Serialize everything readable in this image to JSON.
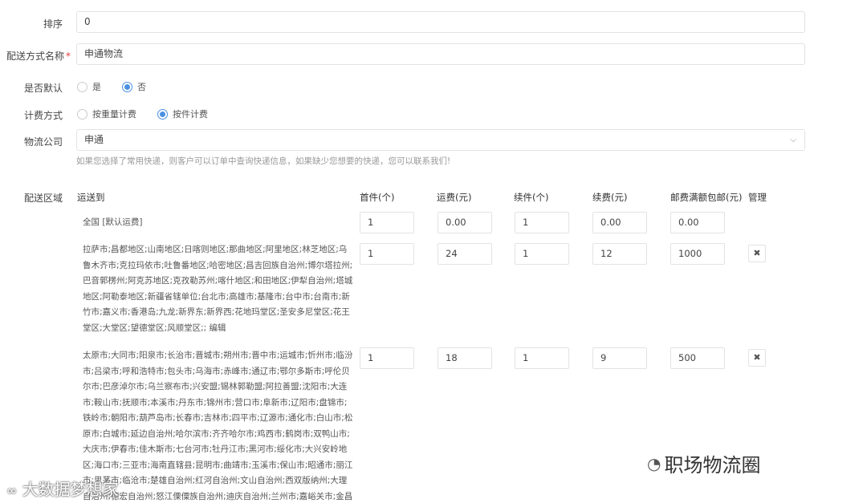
{
  "form": {
    "sort_label": "排序",
    "sort_value": "0",
    "name_label": "配送方式名称",
    "name_required": "*",
    "name_value": "申通物流",
    "default_label": "是否默认",
    "default_yes": "是",
    "default_no": "否",
    "default_selected": "否",
    "billing_label": "计费方式",
    "billing_weight": "按重量计费",
    "billing_piece": "按件计费",
    "billing_selected": "按件计费",
    "company_label": "物流公司",
    "company_value": "申通",
    "company_hint": "如果您选择了常用快递，则客户可以订单中查询快递信息，如果缺少您想要的快递，您可以联系我们!"
  },
  "table": {
    "section_label": "配送区域",
    "headers": {
      "dest": "运送到",
      "first": "首件(个)",
      "first_fee": "运费(元)",
      "extra": "续件(个)",
      "extra_fee": "续费(元)",
      "free": "邮费满额包邮(元)",
      "manage": "管理"
    },
    "rows": [
      {
        "region": "全国 [默认运费]",
        "first": "1",
        "first_fee": "0.00",
        "extra": "1",
        "extra_fee": "0.00",
        "free": "0.00"
      },
      {
        "region": "拉萨市;昌都地区;山南地区;日喀则地区;那曲地区;阿里地区;林芝地区;乌鲁木齐市;克拉玛依市;吐鲁番地区;哈密地区;昌吉回族自治州;博尔塔拉州;巴音郭楞州;阿克苏地区;克孜勒苏州;喀什地区;和田地区;伊犁自治州;塔城地区;阿勒泰地区;新疆省辖单位;台北市;高雄市;基隆市;台中市;台南市;新竹市;嘉义市;香港岛;九龙;新界东;新界西;花地玛堂区;圣安多尼堂区;花王堂区;大堂区;望德堂区;风顺堂区;; 编辑",
        "first": "1",
        "first_fee": "24",
        "extra": "1",
        "extra_fee": "12",
        "free": "1000"
      },
      {
        "region": "太原市;大同市;阳泉市;长治市;晋城市;朔州市;晋中市;运城市;忻州市;临汾市;吕梁市;呼和浩特市;包头市;乌海市;赤峰市;通辽市;鄂尔多斯市;呼伦贝尔市;巴彦淖尔市;乌兰察布市;兴安盟;锡林郭勒盟;阿拉善盟;沈阳市;大连市;鞍山市;抚顺市;本溪市;丹东市;锦州市;营口市;阜新市;辽阳市;盘锦市;铁岭市;朝阳市;葫芦岛市;长春市;吉林市;四平市;辽源市;通化市;白山市;松原市;白城市;延边自治州;哈尔滨市;齐齐哈尔市;鸡西市;鹤岗市;双鸭山市;大庆市;伊春市;佳木斯市;七台河市;牡丹江市;黑河市;绥化市;大兴安岭地区;海口市;三亚市;海南直辖县;昆明市;曲靖市;玉溪市;保山市;昭通市;丽江市;思茅市;临沧市;楚雄自治州;红河自治州;文山自治州;西双版纳州;大理自治州;德宏自治州;怒江傈僳族自治州;迪庆自治州;兰州市;嘉峪关市;金昌市;白银市;天水市;武威市;张掖市;",
        "first": "1",
        "first_fee": "18",
        "extra": "1",
        "extra_fee": "9",
        "free": "500"
      }
    ]
  },
  "watermarks": {
    "left_text": "大数据梦想家",
    "brand_text": "职场物流圈"
  },
  "icons": {
    "delete": "close-x-icon",
    "dropdown": "chevron-down-icon",
    "wechat": "wechat-icon"
  },
  "colors": {
    "accent": "#4a90e2",
    "required": "#e4393c"
  }
}
